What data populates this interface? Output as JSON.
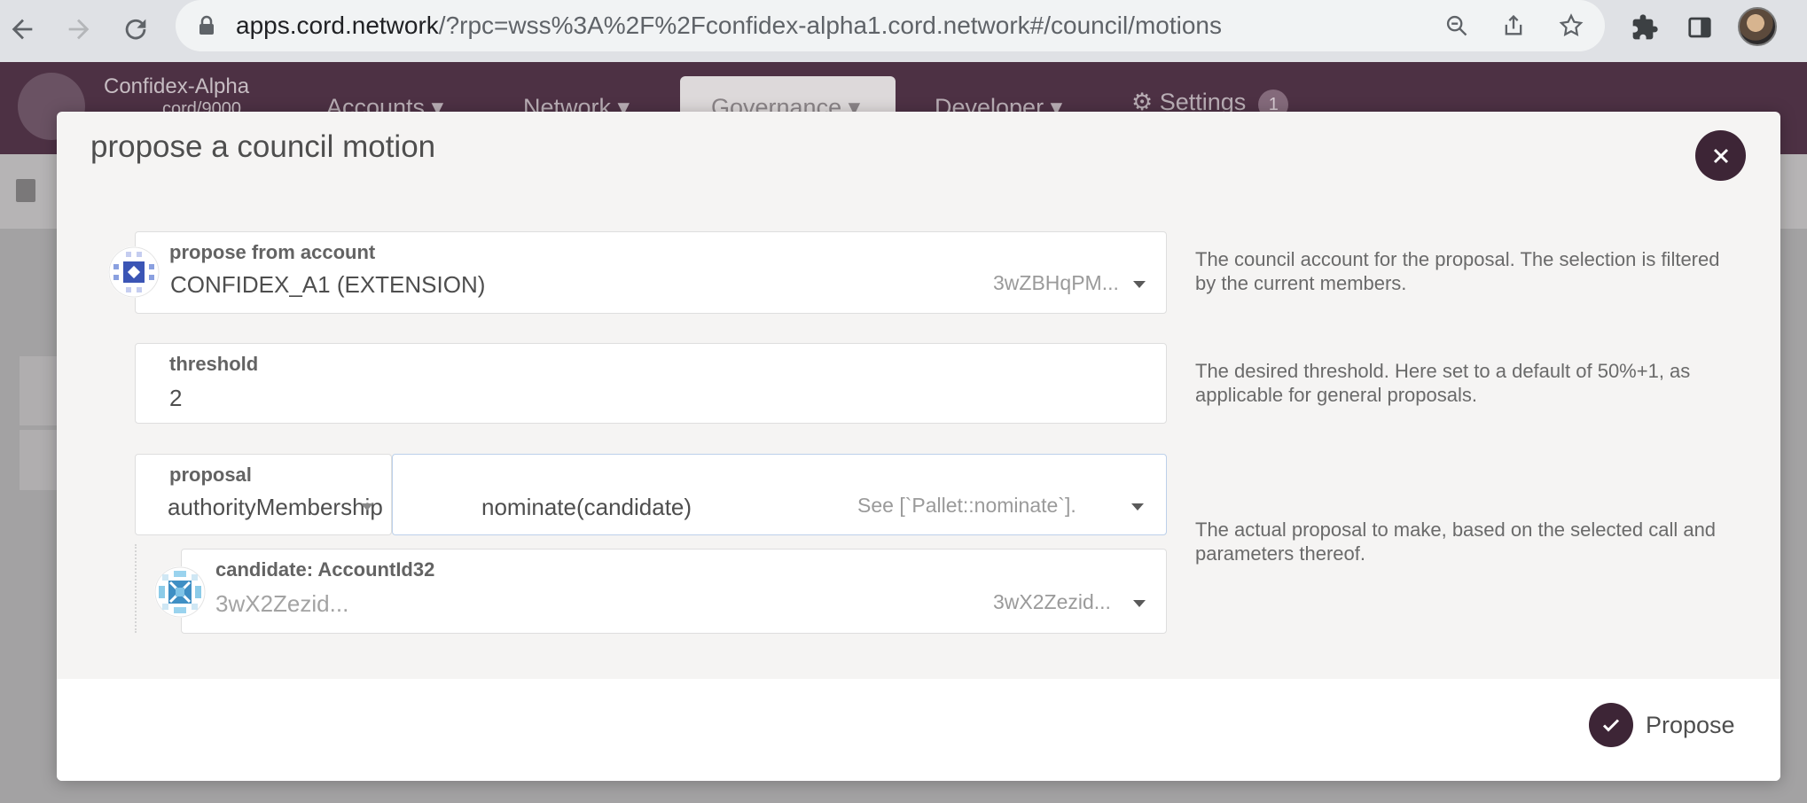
{
  "browser": {
    "url_domain": "apps.cord.network",
    "url_rest": "/?rpc=wss%3A%2F%2Fconfidex-alpha1.cord.network#/council/motions"
  },
  "app": {
    "chain_name": "Confidex-Alpha",
    "chain_sub": "cord/9000",
    "menu": {
      "accounts": "Accounts",
      "network": "Network",
      "governance": "Governance",
      "developer": "Developer",
      "settings": "Settings",
      "settings_badge": "1"
    }
  },
  "modal": {
    "title": "propose a council motion",
    "account": {
      "label": "propose from account",
      "value": "CONFIDEX_A1 (EXTENSION)",
      "address": "3wZBHqPM...",
      "help": "The council account for the proposal. The selection is filtered by the current members."
    },
    "threshold": {
      "label": "threshold",
      "value": "2",
      "help": "The desired threshold. Here set to a default of 50%+1, as applicable for general proposals."
    },
    "proposal": {
      "label": "proposal",
      "section": "authorityMembership",
      "method": "nominate(candidate)",
      "doc": "See [`Pallet::nominate`].",
      "help": "The actual proposal to make, based on the selected call and parameters thereof."
    },
    "candidate": {
      "label": "candidate: AccountId32",
      "value": "3wX2Zezid...",
      "address": "3wX2Zezid..."
    },
    "propose_label": "Propose"
  },
  "colors": {
    "header_bg": "#4d3144",
    "accent": "#3d2536"
  }
}
